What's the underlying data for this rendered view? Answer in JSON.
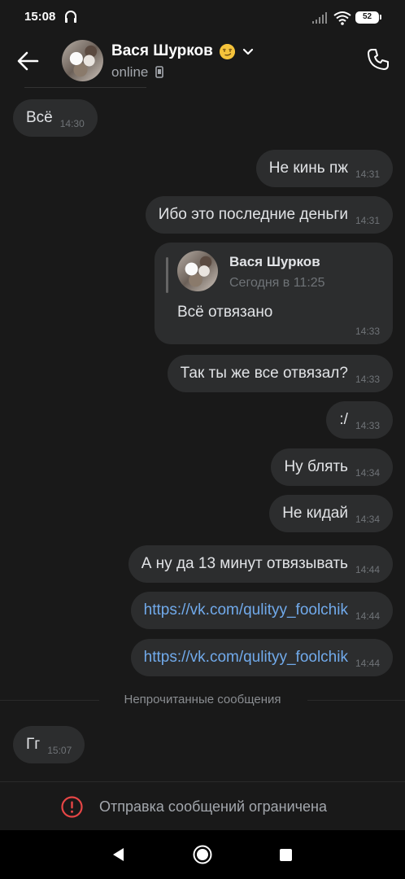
{
  "status_bar": {
    "time": "15:08",
    "battery": "52"
  },
  "header": {
    "contact_name": "Вася Шурков",
    "status": "online",
    "emoji_icon": "smirk-emoji-icon",
    "back_icon": "arrow-left-icon",
    "call_icon": "phone-icon"
  },
  "messages": [
    {
      "side": "in",
      "text": "Всё",
      "time": "14:30"
    },
    {
      "side": "out",
      "text": "Не кинь пж",
      "time": "14:31"
    },
    {
      "side": "out",
      "text": "Ибо это последние деньги",
      "time": "14:31"
    },
    {
      "side": "out",
      "text": "Так ты же все отвязал?",
      "time": "14:33"
    },
    {
      "side": "out",
      "text": ":/",
      "time": "14:33"
    },
    {
      "side": "out",
      "text": "Ну блять",
      "time": "14:34"
    },
    {
      "side": "out",
      "text": "Не кидай",
      "time": "14:34"
    },
    {
      "side": "out",
      "text": "А ну да 13 минут отвязывать",
      "time": "14:44"
    },
    {
      "side": "out",
      "text": "https://vk.com/qulityy_foolchik",
      "time": "14:44",
      "is_link": true
    },
    {
      "side": "out",
      "text": "https://vk.com/qulityy_foolchik",
      "time": "14:44",
      "is_link": true
    },
    {
      "side": "in",
      "text": "Гг",
      "time": "15:07"
    }
  ],
  "reply_message": {
    "quoted_name": "Вася Шурков",
    "quoted_date": "Сегодня в 11:25",
    "text": "Всё отвязано",
    "time": "14:33"
  },
  "unread_divider": "Непрочитанные сообщения",
  "restricted": {
    "text": "Отправка сообщений ограничена",
    "icon": "warning-circle-icon"
  },
  "colors": {
    "background": "#191919",
    "bubble": "#2c2d2e",
    "link": "#71aaeb",
    "warning": "#e64646"
  }
}
